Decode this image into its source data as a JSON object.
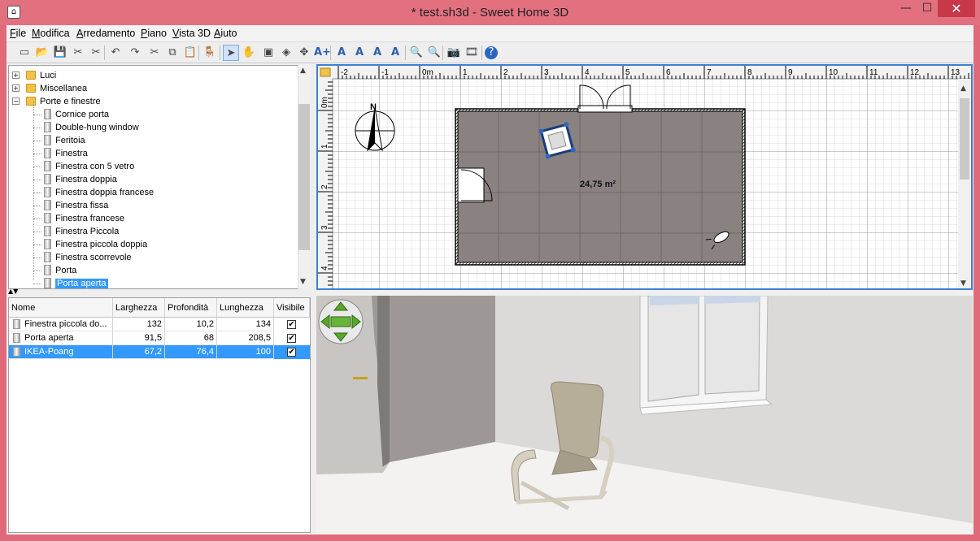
{
  "window": {
    "title": "* test.sh3d - Sweet Home 3D",
    "minimize": "—",
    "maximize": "☐",
    "close": "✕"
  },
  "menubar": [
    "File",
    "Modifica",
    "Arredamento",
    "Piano",
    "Vista 3D",
    "Aiuto"
  ],
  "toolbar": {
    "icons": [
      "new-file-icon",
      "open-icon",
      "save-icon",
      "preferences-icon",
      "cut-tool-icon",
      "undo-icon",
      "redo-icon",
      "cut-icon",
      "copy-icon",
      "paste-icon",
      "add-furniture-icon",
      "select-icon",
      "pan-icon",
      "create-walls-icon",
      "create-rooms-icon",
      "create-dimensions-icon",
      "add-text-icon",
      "text-style-bold-icon",
      "text-style-italic-icon",
      "increase-text-icon",
      "decrease-text-icon",
      "zoom-in-icon",
      "zoom-out-icon",
      "create-photo-icon",
      "create-video-icon",
      "help-icon"
    ],
    "glyphs": [
      "▭",
      "📂",
      "💾",
      "✂",
      "✂",
      "↶",
      "↷",
      "✂",
      "⧉",
      "📋",
      "🪑",
      "➤",
      "✋",
      "▣",
      "◈",
      "✥",
      "A+",
      "A",
      "A",
      "A",
      "A",
      "🔍",
      "🔍",
      "📷",
      "🎞",
      "?"
    ]
  },
  "catalog": {
    "items": [
      {
        "label": "Luci",
        "type": "folder",
        "expander": "+"
      },
      {
        "label": "Miscellanea",
        "type": "folder",
        "expander": "+"
      },
      {
        "label": "Porte e finestre",
        "type": "folder",
        "expander": "−"
      },
      {
        "label": "Cornice porta",
        "type": "item"
      },
      {
        "label": "Double-hung window",
        "type": "item"
      },
      {
        "label": "Feritoia",
        "type": "item"
      },
      {
        "label": "Finestra",
        "type": "item"
      },
      {
        "label": "Finestra con 5 vetro",
        "type": "item"
      },
      {
        "label": "Finestra doppia",
        "type": "item"
      },
      {
        "label": "Finestra doppia francese",
        "type": "item"
      },
      {
        "label": "Finestra fissa",
        "type": "item"
      },
      {
        "label": "Finestra francese",
        "type": "item"
      },
      {
        "label": "Finestra Piccola",
        "type": "item"
      },
      {
        "label": "Finestra piccola doppia",
        "type": "item"
      },
      {
        "label": "Finestra scorrevole",
        "type": "item"
      },
      {
        "label": "Porta",
        "type": "item"
      },
      {
        "label": "Porta aperta",
        "type": "item",
        "selected": true
      }
    ]
  },
  "furniture_table": {
    "columns": [
      "Nome",
      "Larghezza",
      "Profondità",
      "Lunghezza",
      "Visibile"
    ],
    "rows": [
      {
        "name": "Finestra piccola do...",
        "width": "132",
        "depth": "10,2",
        "length": "134",
        "visible": true,
        "selected": false
      },
      {
        "name": "Porta aperta",
        "width": "91,5",
        "depth": "68",
        "length": "208,5",
        "visible": true,
        "selected": false
      },
      {
        "name": "IKEA-Poang",
        "width": "67,2",
        "depth": "76,4",
        "length": "100",
        "visible": true,
        "selected": true
      }
    ]
  },
  "plan": {
    "ruler_x": [
      "-2",
      "-1",
      "0m",
      "1",
      "2",
      "3",
      "4",
      "5",
      "6",
      "7",
      "8",
      "9",
      "10",
      "11",
      "12",
      "13"
    ],
    "ruler_y": [
      "0m",
      "1",
      "2",
      "3",
      "4"
    ],
    "compass_label": "N",
    "room_area": "24,75 m²"
  },
  "colors": {
    "selection": "#3399ff",
    "title_bar": "#e3707f",
    "plan_border": "#3c7fd6",
    "room_fill": "#8a8280"
  }
}
